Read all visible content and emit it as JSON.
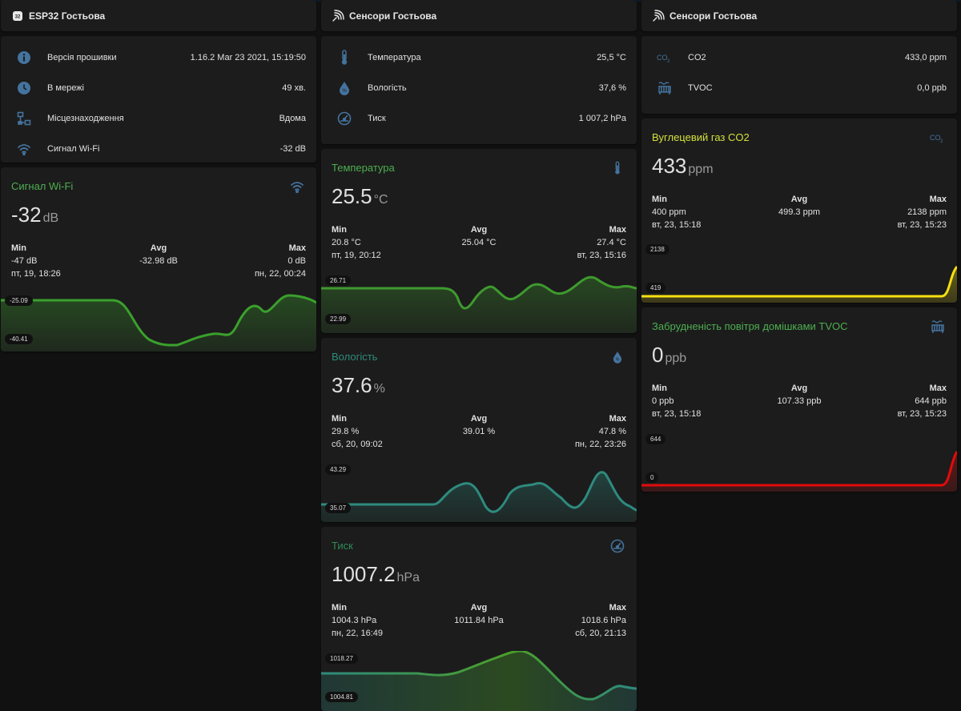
{
  "col1": {
    "header": {
      "title": "ESP32 Гостьова",
      "icon": "chip-icon"
    },
    "entities": [
      {
        "icon": "info-icon",
        "label": "Версія прошивки",
        "value": "1.16.2 Mar 23 2021, 15:19:50"
      },
      {
        "icon": "clock-icon",
        "label": "В мережі",
        "value": "49 хв."
      },
      {
        "icon": "network-icon",
        "label": "Місцезнаходження",
        "value": "Вдома"
      },
      {
        "icon": "wifi-icon",
        "label": "Сигнал Wi-Fi",
        "value": "-32 dB"
      }
    ],
    "wifi_card": {
      "title": "Сигнал Wi-Fi",
      "title_color": "#4caf50",
      "icon": "wifi-icon",
      "value": "-32",
      "unit": "dB",
      "min_h": "Min",
      "min_v": "-47 dB",
      "min_t": "пт, 19, 18:26",
      "avg_h": "Avg",
      "avg_v": "-32.98 dB",
      "max_h": "Max",
      "max_v": "0 dB",
      "max_t": "пн, 22, 00:24",
      "label_top": "-25.09",
      "label_bottom": "-40.41"
    }
  },
  "col2": {
    "header": {
      "title": "Сенсори Гостьова",
      "icon": "sensors-icon"
    },
    "entities": [
      {
        "icon": "thermometer-icon",
        "label": "Температура",
        "value": "25,5 °C"
      },
      {
        "icon": "water-icon",
        "label": "Вологість",
        "value": "37,6 %"
      },
      {
        "icon": "gauge-icon",
        "label": "Тиск",
        "value": "1 007,2 hPa"
      }
    ],
    "temp_card": {
      "title": "Температура",
      "title_color": "#4caf50",
      "icon": "thermometer-icon",
      "value": "25.5",
      "unit": "°C",
      "min_h": "Min",
      "min_v": "20.8 °C",
      "min_t": "пт, 19, 20:12",
      "avg_h": "Avg",
      "avg_v": "25.04 °C",
      "max_h": "Max",
      "max_v": "27.4 °C",
      "max_t": "вт, 23, 15:16",
      "label_top": "26.71",
      "label_bottom": "22.99"
    },
    "hum_card": {
      "title": "Вологість",
      "title_color": "#2e8b7a",
      "icon": "water-icon",
      "value": "37.6",
      "unit": "%",
      "min_h": "Min",
      "min_v": "29.8 %",
      "min_t": "сб, 20, 09:02",
      "avg_h": "Avg",
      "avg_v": "39.01 %",
      "max_h": "Max",
      "max_v": "47.8 %",
      "max_t": "пн, 22, 23:26",
      "label_top": "43.29",
      "label_bottom": "35.07"
    },
    "press_card": {
      "title": "Тиск",
      "title_color": "#2e8b57",
      "icon": "gauge-icon",
      "value": "1007.2",
      "unit": "hPa",
      "min_h": "Min",
      "min_v": "1004.3 hPa",
      "min_t": "пн, 22, 16:49",
      "avg_h": "Avg",
      "avg_v": "1011.84 hPa",
      "max_h": "Max",
      "max_v": "1018.6 hPa",
      "max_t": "сб, 20, 21:13",
      "label_top": "1018.27",
      "label_bottom": "1004.81"
    }
  },
  "col3": {
    "header": {
      "title": "Сенсори Гостьова",
      "icon": "sensors-icon"
    },
    "entities": [
      {
        "icon": "co2-icon",
        "label": "CO2",
        "value": "433,0 ppm"
      },
      {
        "icon": "air-filter-icon",
        "label": "TVOC",
        "value": "0,0 ppb"
      }
    ],
    "co2_card": {
      "title": "Вуглецевий газ CO2",
      "title_color": "#d4e03a",
      "icon": "co2-icon",
      "value": "433",
      "unit": "ppm",
      "min_h": "Min",
      "min_v": "400 ppm",
      "min_t": "вт, 23, 15:18",
      "avg_h": "Avg",
      "avg_v": "499.3 ppm",
      "max_h": "Max",
      "max_v": "2138 ppm",
      "max_t": "вт, 23, 15:23",
      "label_top": "2138",
      "label_bottom": "419"
    },
    "tvoc_card": {
      "title": "Забрудненість повітря домішками TVOC",
      "title_color": "#4caf50",
      "icon": "air-filter-icon",
      "value": "0",
      "unit": "ppb",
      "min_h": "Min",
      "min_v": "0 ppb",
      "min_t": "вт, 23, 15:18",
      "avg_h": "Avg",
      "avg_v": "107.33 ppb",
      "max_h": "Max",
      "max_v": "644 ppb",
      "max_t": "вт, 23, 15:23",
      "label_top": "644",
      "label_bottom": "0"
    }
  },
  "colors": {
    "icon_blue": "#44739e",
    "wifi_line": "#3aa02c",
    "temp_line": "#3e9a2e",
    "hum_line": "#2e8a7e",
    "press_line": "#3aa040",
    "co2_line": "#f5e10f",
    "tvoc_line": "#e30b0b"
  }
}
